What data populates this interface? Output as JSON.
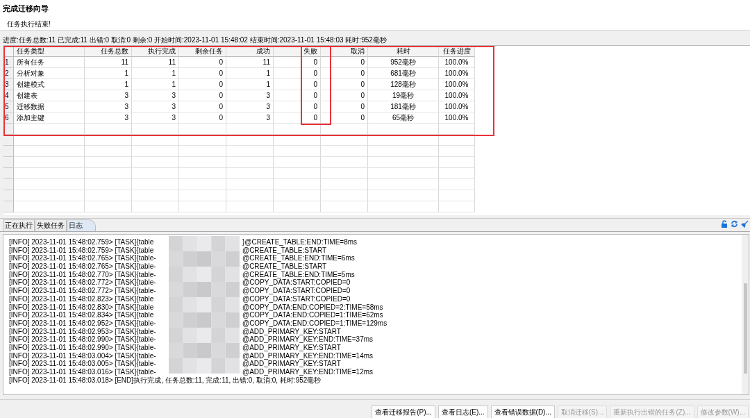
{
  "window": {
    "title": "完成迁移向导",
    "subtitle": "任务执行结束!"
  },
  "progress_text": "进度:任务总数:11 已完成:11 出错:0 取消:0 剩余:0 开始时间:2023-11-01 15:48:02 结束时间:2023-11-01 15:48:03 耗时:952毫秒",
  "table": {
    "highlighted": true,
    "columns": [
      {
        "label": "任务类型",
        "highlighted": false
      },
      {
        "label": "任务总数",
        "highlighted": false
      },
      {
        "label": "执行完成",
        "highlighted": false
      },
      {
        "label": "剩余任务",
        "highlighted": false
      },
      {
        "label": "成功",
        "highlighted": false
      },
      {
        "label": "失败",
        "highlighted": true
      },
      {
        "label": "取消",
        "highlighted": false
      },
      {
        "label": "耗时",
        "highlighted": false
      },
      {
        "label": "任务进度",
        "highlighted": false
      }
    ],
    "rows": [
      {
        "index": "1",
        "cells": [
          "所有任务",
          "11",
          "11",
          "0",
          "11",
          "0",
          "0",
          "952毫秒",
          "100.0%"
        ]
      },
      {
        "index": "2",
        "cells": [
          "分析对象",
          "1",
          "1",
          "0",
          "1",
          "0",
          "0",
          "681毫秒",
          "100.0%"
        ]
      },
      {
        "index": "3",
        "cells": [
          "创建模式",
          "1",
          "1",
          "0",
          "1",
          "0",
          "0",
          "128毫秒",
          "100.0%"
        ]
      },
      {
        "index": "4",
        "cells": [
          "创建表",
          "3",
          "3",
          "0",
          "3",
          "0",
          "0",
          "19毫秒",
          "100.0%"
        ]
      },
      {
        "index": "5",
        "cells": [
          "迁移数据",
          "3",
          "3",
          "0",
          "3",
          "0",
          "0",
          "181毫秒",
          "100.0%"
        ]
      },
      {
        "index": "6",
        "cells": [
          "添加主键",
          "3",
          "3",
          "0",
          "3",
          "0",
          "0",
          "65毫秒",
          "100.0%"
        ]
      }
    ]
  },
  "tabs": [
    {
      "label": "正在执行",
      "selected": false
    },
    {
      "label": "失败任务",
      "selected": false
    },
    {
      "label": "日志",
      "selected": true
    }
  ],
  "log": [
    {
      "prefix": "[INFO] 2023-11-01 15:48:02.759> [TASK]{table",
      "suffix": "}@CREATE_TABLE:END:TIME=8ms"
    },
    {
      "prefix": "[INFO] 2023-11-01 15:48:02.759> [TASK]{table",
      "suffix": "@CREATE_TABLE:START"
    },
    {
      "prefix": "[INFO] 2023-11-01 15:48:02.765> [TASK]{table-",
      "suffix": "@CREATE_TABLE:END:TIME=6ms"
    },
    {
      "prefix": "[INFO] 2023-11-01 15:48:02.765> [TASK]{table-",
      "suffix": "@CREATE_TABLE:START"
    },
    {
      "prefix": "[INFO] 2023-11-01 15:48:02.770> [TASK]{table-",
      "suffix": "@CREATE_TABLE:END:TIME=5ms"
    },
    {
      "prefix": "[INFO] 2023-11-01 15:48:02.772> [TASK]{table-",
      "suffix": "@COPY_DATA:START:COPIED=0"
    },
    {
      "prefix": "[INFO] 2023-11-01 15:48:02.772> [TASK]{table-",
      "suffix": "@COPY_DATA:START:COPIED=0"
    },
    {
      "prefix": "[INFO] 2023-11-01 15:48:02.823> [TASK]{table",
      "suffix": "@COPY_DATA:START:COPIED=0"
    },
    {
      "prefix": "[INFO] 2023-11-01 15:48:02.830> [TASK]{table",
      "suffix": "@COPY_DATA:END:COPIED=2:TIME=58ms"
    },
    {
      "prefix": "[INFO] 2023-11-01 15:48:02.834> [TASK]{table",
      "suffix": "@COPY_DATA:END:COPIED=1:TIME=62ms"
    },
    {
      "prefix": "[INFO] 2023-11-01 15:48:02.952> [TASK]{table-",
      "suffix": "@COPY_DATA:END:COPIED=1:TIME=129ms"
    },
    {
      "prefix": "[INFO] 2023-11-01 15:48:02.953> [TASK]{table-",
      "suffix": "@ADD_PRIMARY_KEY:START"
    },
    {
      "prefix": "[INFO] 2023-11-01 15:48:02.990> [TASK]{table-",
      "suffix": "@ADD_PRIMARY_KEY:END:TIME=37ms"
    },
    {
      "prefix": "[INFO] 2023-11-01 15:48:02.990> [TASK]{table-",
      "suffix": "@ADD_PRIMARY_KEY:START"
    },
    {
      "prefix": "[INFO] 2023-11-01 15:48:03.004> [TASK]{table-",
      "suffix": "@ADD_PRIMARY_KEY:END:TIME=14ms"
    },
    {
      "prefix": "[INFO] 2023-11-01 15:48:03.005> [TASK]{table-",
      "suffix": "@ADD_PRIMARY_KEY:START"
    },
    {
      "prefix": "[INFO] 2023-11-01 15:48:03.016> [TASK]{table-",
      "suffix": "@ADD_PRIMARY_KEY:END:TIME=12ms"
    },
    {
      "prefix": "[INFO] 2023-11-01 15:48:03.018> [END]执行完成, 任务总数:11, 完成:11, 出错:0, 取消:0, 耗时:952毫秒"
    }
  ],
  "buttons": [
    {
      "label": "查看迁移报告(P)...",
      "disabled": false
    },
    {
      "label": "查看日志(E)...",
      "disabled": false
    },
    {
      "label": "查看错误数据(D)...",
      "disabled": false
    },
    {
      "label": "取消迁移(S)...",
      "disabled": true
    },
    {
      "label": "重新执行出错的任务(Z)...",
      "disabled": true
    },
    {
      "label": "修改参数(W)...",
      "disabled": true
    }
  ]
}
